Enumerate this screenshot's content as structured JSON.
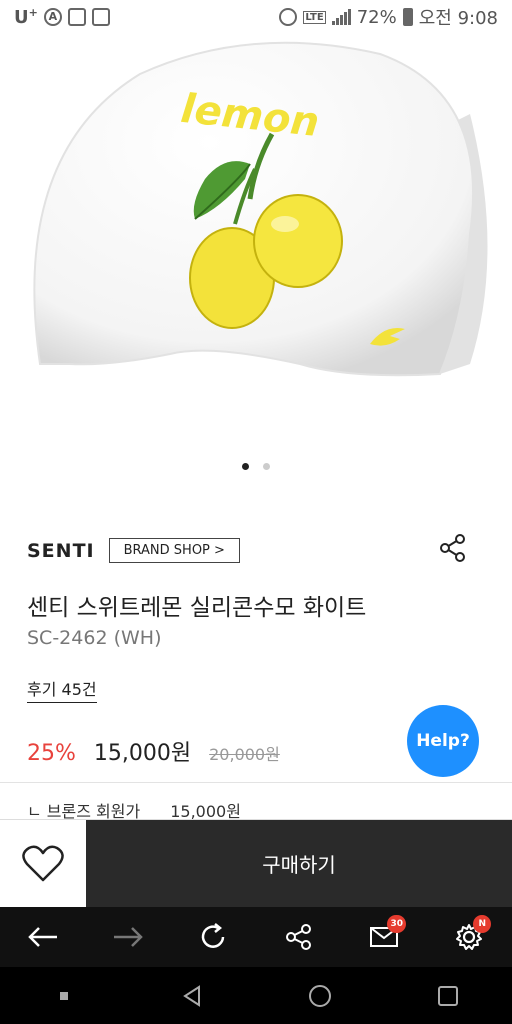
{
  "status_bar": {
    "carrier": "U",
    "carrier_sup": "+",
    "carrier_icon": "A",
    "network": "LTE",
    "battery": "72%",
    "time": "오전 9:08"
  },
  "gallery": {
    "current_index": 1,
    "total": 2
  },
  "product": {
    "image_text": "lemon",
    "brand": "SENTI",
    "brand_shop_label": "BRAND SHOP >",
    "title": "센티 스위트레몬 실리콘수모 화이트",
    "model": "SC-2462 (WH)",
    "review_label": "후기 45건",
    "discount": "25%",
    "price": "15,000원",
    "original_price": "20,000원",
    "member_label": "ㄴ 브론즈 회원가",
    "member_price": "15,000원"
  },
  "help_button": {
    "label": "Help?"
  },
  "actions": {
    "buy_label": "구매하기"
  },
  "browser_nav": {
    "mail_badge": "30",
    "settings_badge": "N"
  },
  "colors": {
    "accent_discount": "#e8423c",
    "help_blue": "#1e90ff",
    "buy_bg": "#2a2a2a",
    "lemon_yellow": "#f3e23a"
  }
}
